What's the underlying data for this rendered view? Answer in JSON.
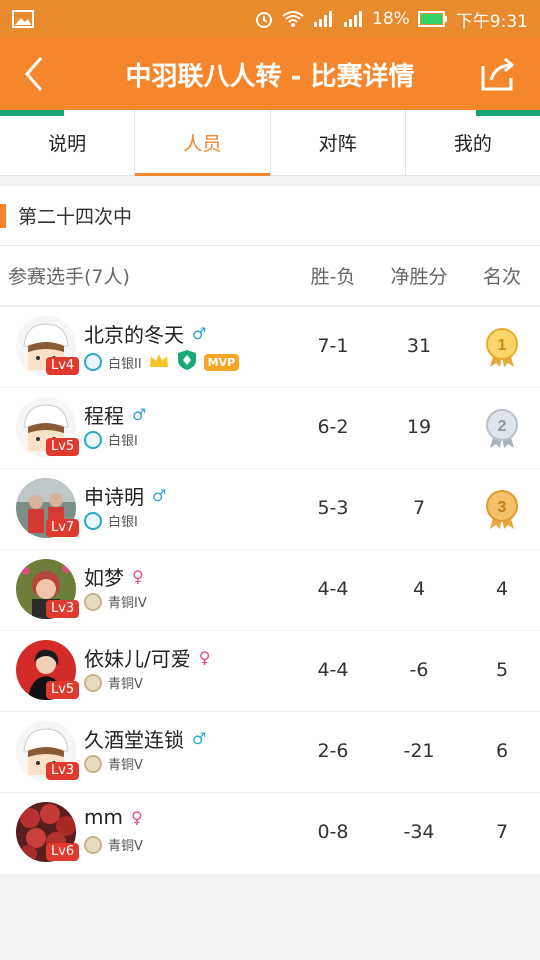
{
  "status": {
    "battery": "18%",
    "time": "下午9:31"
  },
  "titlebar": {
    "title": "中羽联八人转 - 比赛详情"
  },
  "tabs": [
    {
      "label": "说明"
    },
    {
      "label": "人员"
    },
    {
      "label": "对阵"
    },
    {
      "label": "我的"
    }
  ],
  "section": {
    "title": "第二十四次中"
  },
  "table": {
    "header": {
      "name": "参赛选手(7人)",
      "wl": "胜-负",
      "net": "净胜分",
      "rank": "名次"
    },
    "rows": [
      {
        "name": "北京的冬天",
        "gender": "♂",
        "level": "Lv4",
        "tier": "白银II",
        "wl": "7-1",
        "net": "31",
        "rank": "1",
        "mvp": "MVP"
      },
      {
        "name": "程程",
        "gender": "♂",
        "level": "Lv5",
        "tier": "白银I",
        "wl": "6-2",
        "net": "19",
        "rank": "2"
      },
      {
        "name": "申诗明",
        "gender": "♂",
        "level": "Lv7",
        "tier": "白银I",
        "wl": "5-3",
        "net": "7",
        "rank": "3"
      },
      {
        "name": "如梦",
        "gender": "♀",
        "level": "Lv3",
        "tier": "青铜IV",
        "wl": "4-4",
        "net": "4",
        "rank": "4"
      },
      {
        "name": "依妹儿/可爱",
        "gender": "♀",
        "level": "Lv5",
        "tier": "青铜V",
        "wl": "4-4",
        "net": "-6",
        "rank": "5"
      },
      {
        "name": "久酒堂连锁",
        "gender": "♂",
        "level": "Lv3",
        "tier": "青铜V",
        "wl": "2-6",
        "net": "-21",
        "rank": "6"
      },
      {
        "name": "mm",
        "gender": "♀",
        "level": "Lv6",
        "tier": "青铜V",
        "wl": "0-8",
        "net": "-34",
        "rank": "7"
      }
    ]
  }
}
